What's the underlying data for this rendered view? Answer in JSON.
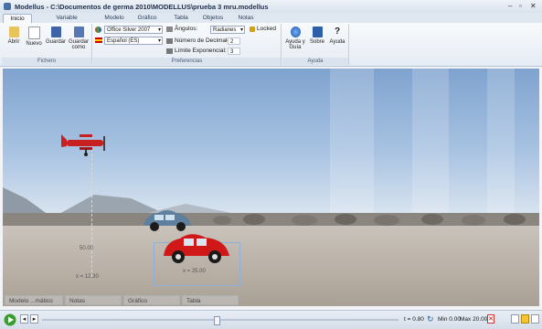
{
  "window": {
    "title": "Modellus - C:\\Documentos de germa 2010\\MODELLUS\\prueba 3 mru.modellus",
    "controls": [
      "–",
      "▫",
      "✕"
    ]
  },
  "tabs": [
    "Inicio",
    "Variable Independiente",
    "Modelo",
    "Gráfico",
    "Tabla",
    "Objetos",
    "Notas"
  ],
  "ribbon": {
    "fichero": {
      "label": "Fichero",
      "buttons": [
        "Abrir",
        "Nuevo",
        "Guardar",
        "Guardar como"
      ]
    },
    "preferencias": {
      "label": "Preferencias",
      "theme": "Office Silver 2007",
      "language": "Español (ES)",
      "angles_label": "Ângulos:",
      "angles_value": "Radianes",
      "locked_label": "Locked",
      "decimals_label": "Número de Decimales:",
      "decimals_value": "2",
      "exp_label": "Límite Exponencial:",
      "exp_value": "3"
    },
    "ayuda": {
      "label": "Ayuda",
      "buttons": [
        "Ayuda y Guía",
        "Sobre",
        "Ayuda"
      ]
    }
  },
  "scene": {
    "plane_label": "50.00",
    "plane_x_label": "x = 12.30",
    "car_x_label": "x = 25.00"
  },
  "bottom_tabs": [
    "Modelo ...mático",
    "Notas",
    "Gráfico",
    "Tabla"
  ],
  "status": {
    "t_label": "t = 0.80",
    "min_label": "Min 0.00",
    "max_label": "Max 20.00"
  }
}
